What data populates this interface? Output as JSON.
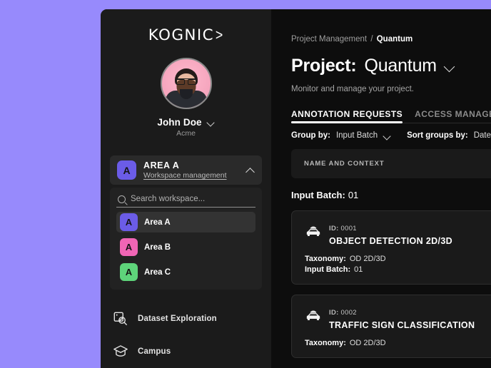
{
  "theme": {
    "desktop_background": "#978afc",
    "sidebar_background": "#1b1b1b",
    "main_background": "#0d0d0d",
    "accent_white": "#ffffff"
  },
  "sidebar": {
    "logo": {
      "text": "KOGNIC",
      "chevron": ">"
    },
    "user": {
      "name": "John Doe",
      "organization": "Acme",
      "avatar_icon": "user-avatar-photo",
      "menu_icon": "chevron-down-icon"
    },
    "workspace_header": {
      "badge_letter": "A",
      "badge_color": "#6b5ce7",
      "title": "AREA A",
      "subtitle": "Workspace management",
      "collapse_icon": "chevron-up-icon"
    },
    "search": {
      "placeholder": "Search workspace...",
      "value": "",
      "icon": "search-icon"
    },
    "workspaces": [
      {
        "label": "Area A",
        "badge_letter": "A",
        "color": "#6b5ce7",
        "active": true
      },
      {
        "label": "Area B",
        "badge_letter": "A",
        "color": "#f065b5",
        "active": false
      },
      {
        "label": "Area C",
        "badge_letter": "A",
        "color": "#5ed47a",
        "active": false
      }
    ],
    "nav": [
      {
        "label": "Dataset Exploration",
        "icon": "image-search-icon"
      },
      {
        "label": "Campus",
        "icon": "graduation-cap-icon"
      }
    ]
  },
  "main": {
    "breadcrumb": {
      "root": "Project Management",
      "separator": "/",
      "current": "Quantum"
    },
    "page_title": {
      "label": "Project:",
      "value": "Quantum",
      "chevron": "chevron-down-icon"
    },
    "subtitle": "Monitor and manage your project.",
    "tabs": [
      {
        "label": "ANNOTATION REQUESTS",
        "active": true
      },
      {
        "label": "ACCESS MANAGEMENT",
        "active": false
      }
    ],
    "toolbar": {
      "group_by_label": "Group by:",
      "group_by_value": "Input Batch",
      "group_by_chevron": "chevron-down-icon",
      "sort_by_label": "Sort groups by:",
      "sort_by_value": "Date"
    },
    "list_header": {
      "name_and_context": "NAME AND CONTEXT"
    },
    "group": {
      "label": "Input Batch:",
      "value": "01"
    },
    "requests": [
      {
        "icon": "lidar-car-icon",
        "id_label": "ID:",
        "id_value": "0001",
        "name": "OBJECT DETECTION 2D/3D",
        "meta": [
          {
            "key": "Taxonomy:",
            "value": "OD 2D/3D"
          },
          {
            "key": "Input Batch:",
            "value": "01"
          }
        ]
      },
      {
        "icon": "lidar-car-icon",
        "id_label": "ID:",
        "id_value": "0002",
        "name": "TRAFFIC SIGN CLASSIFICATION",
        "meta": [
          {
            "key": "Taxonomy:",
            "value": "OD 2D/3D"
          }
        ]
      }
    ]
  }
}
